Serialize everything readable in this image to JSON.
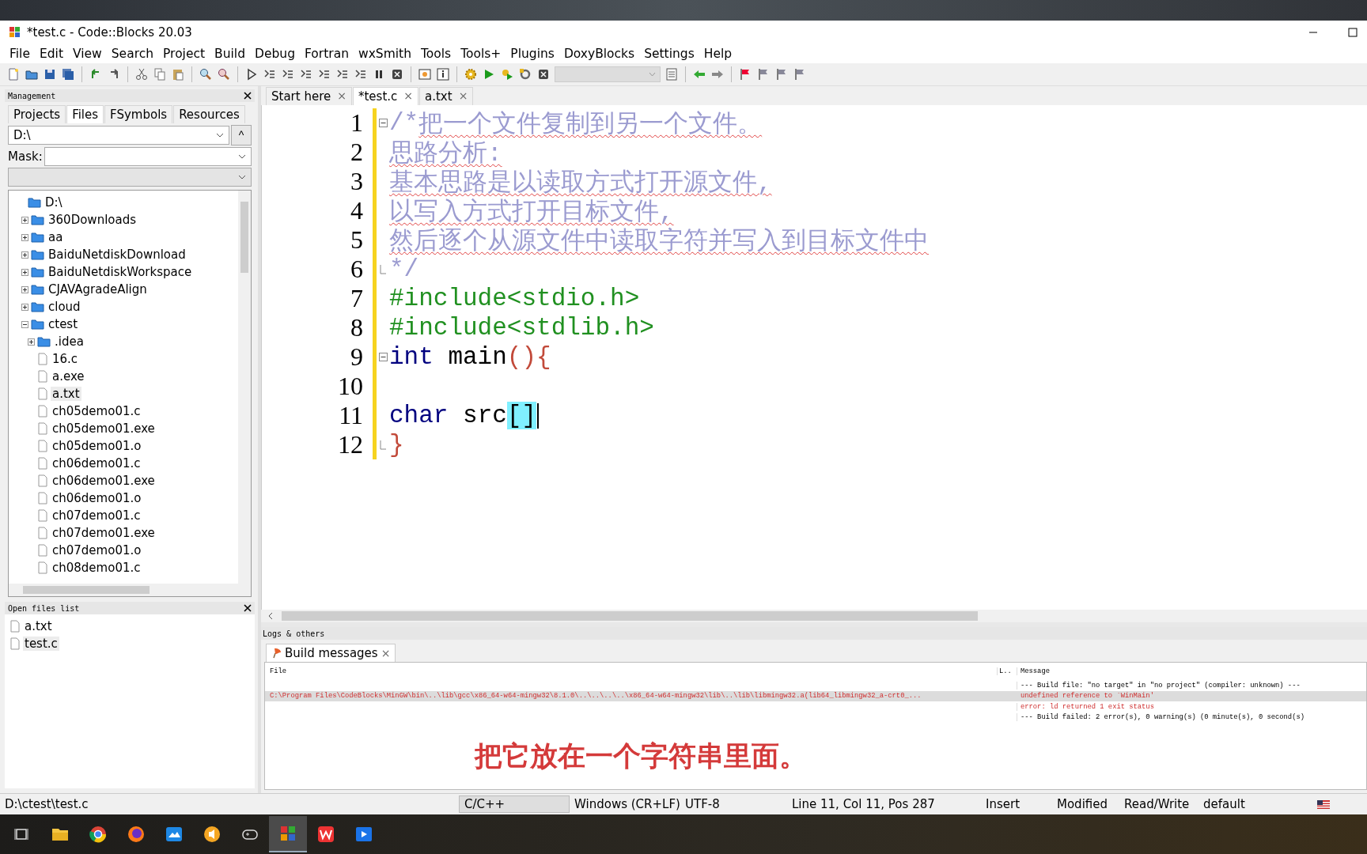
{
  "window": {
    "title": "*test.c - Code::Blocks 20.03"
  },
  "menu": [
    "File",
    "Edit",
    "View",
    "Search",
    "Project",
    "Build",
    "Debug",
    "Fortran",
    "wxSmith",
    "Tools",
    "Tools+",
    "Plugins",
    "DoxyBlocks",
    "Settings",
    "Help"
  ],
  "management": {
    "title": "Management",
    "tabs": [
      {
        "label": "Projects",
        "selected": false
      },
      {
        "label": "Files",
        "selected": true
      },
      {
        "label": "FSymbols",
        "selected": false
      },
      {
        "label": "Resources",
        "selected": false
      }
    ],
    "path": "D:\\",
    "up_button": "^",
    "mask_label": "Mask:",
    "tree": [
      {
        "label": "D:\\",
        "kind": "folder",
        "selected": false,
        "children": [
          {
            "label": "360Downloads",
            "kind": "folder",
            "expanded": false,
            "selected": false
          },
          {
            "label": "aa",
            "kind": "folder",
            "expanded": false,
            "selected": false
          },
          {
            "label": "BaiduNetdiskDownload",
            "kind": "folder",
            "expanded": false,
            "selected": false
          },
          {
            "label": "BaiduNetdiskWorkspace",
            "kind": "folder",
            "expanded": false,
            "selected": false
          },
          {
            "label": "CJAVAgradeAlign",
            "kind": "folder",
            "expanded": false,
            "selected": false
          },
          {
            "label": "cloud",
            "kind": "folder",
            "expanded": false,
            "selected": false
          },
          {
            "label": "ctest",
            "kind": "folder",
            "expanded": true,
            "selected": false,
            "children": [
              {
                "label": ".idea",
                "kind": "folder",
                "expanded": false,
                "selected": false
              },
              {
                "label": "16.c",
                "kind": "file",
                "selected": false
              },
              {
                "label": "a.exe",
                "kind": "file",
                "selected": false
              },
              {
                "label": "a.txt",
                "kind": "file",
                "selected": true
              },
              {
                "label": "ch05demo01.c",
                "kind": "file",
                "selected": false
              },
              {
                "label": "ch05demo01.exe",
                "kind": "file",
                "selected": false
              },
              {
                "label": "ch05demo01.o",
                "kind": "file",
                "selected": false
              },
              {
                "label": "ch06demo01.c",
                "kind": "file",
                "selected": false
              },
              {
                "label": "ch06demo01.exe",
                "kind": "file",
                "selected": false
              },
              {
                "label": "ch06demo01.o",
                "kind": "file",
                "selected": false
              },
              {
                "label": "ch07demo01.c",
                "kind": "file",
                "selected": false
              },
              {
                "label": "ch07demo01.exe",
                "kind": "file",
                "selected": false
              },
              {
                "label": "ch07demo01.o",
                "kind": "file",
                "selected": false
              },
              {
                "label": "ch08demo01.c",
                "kind": "file",
                "selected": false
              }
            ]
          }
        ]
      }
    ]
  },
  "open_files": {
    "title": "Open files list",
    "items": [
      {
        "label": "a.txt",
        "selected": false
      },
      {
        "label": "test.c",
        "selected": true
      }
    ]
  },
  "editor": {
    "tabs": [
      {
        "label": "Start here",
        "selected": false,
        "close": "×"
      },
      {
        "label": "*test.c",
        "selected": true,
        "close": "×"
      },
      {
        "label": "a.txt",
        "selected": false,
        "close": "×"
      }
    ],
    "lines": [
      {
        "number": "1",
        "fold_open": true,
        "fold_end": false,
        "changed": true,
        "caret": false,
        "tokens": [
          {
            "kind": "comment",
            "text": "/*"
          },
          {
            "kind": "comment-marked",
            "text": "把一个文件复制到另一个文件。"
          }
        ]
      },
      {
        "number": "2",
        "fold_open": false,
        "fold_end": false,
        "changed": true,
        "caret": false,
        "tokens": [
          {
            "kind": "comment-marked",
            "text": "思路分析:"
          }
        ]
      },
      {
        "number": "3",
        "fold_open": false,
        "fold_end": false,
        "changed": true,
        "caret": false,
        "tokens": [
          {
            "kind": "comment-marked",
            "text": "基本思路是以读取方式打开源文件,"
          }
        ]
      },
      {
        "number": "4",
        "fold_open": false,
        "fold_end": false,
        "changed": true,
        "caret": false,
        "tokens": [
          {
            "kind": "comment-marked",
            "text": "以写入方式打开目标文件,"
          }
        ]
      },
      {
        "number": "5",
        "fold_open": false,
        "fold_end": false,
        "changed": true,
        "caret": false,
        "tokens": [
          {
            "kind": "comment-marked",
            "text": "然后逐个从源文件中读取字符并写入到目标文件中"
          }
        ]
      },
      {
        "number": "6",
        "fold_open": false,
        "fold_end": true,
        "changed": true,
        "caret": false,
        "tokens": [
          {
            "kind": "comment",
            "text": "*/"
          }
        ]
      },
      {
        "number": "7",
        "fold_open": false,
        "fold_end": false,
        "changed": true,
        "caret": false,
        "tokens": [
          {
            "kind": "preproc",
            "text": "#include<stdio.h>"
          }
        ]
      },
      {
        "number": "8",
        "fold_open": false,
        "fold_end": false,
        "changed": true,
        "caret": false,
        "tokens": [
          {
            "kind": "preproc",
            "text": "#include<stdlib.h>"
          }
        ]
      },
      {
        "number": "9",
        "fold_open": true,
        "fold_end": false,
        "changed": true,
        "caret": false,
        "tokens": [
          {
            "kind": "keyword",
            "text": "int"
          },
          {
            "kind": "plain",
            "text": " main"
          },
          {
            "kind": "brace",
            "text": "(){"
          }
        ]
      },
      {
        "number": "10",
        "fold_open": false,
        "fold_end": false,
        "changed": true,
        "caret": false
      },
      {
        "number": "11",
        "fold_open": false,
        "fold_end": false,
        "changed": true,
        "caret": true,
        "tokens": [
          {
            "kind": "keyword",
            "text": "char"
          },
          {
            "kind": "plain",
            "text": " src"
          },
          {
            "kind": "match",
            "text": "[]"
          }
        ]
      },
      {
        "number": "12",
        "fold_open": false,
        "fold_end": true,
        "changed": true,
        "caret": false,
        "tokens": [
          {
            "kind": "brace",
            "text": "}"
          }
        ]
      }
    ]
  },
  "logs": {
    "title": "Logs & others",
    "tabs": [
      {
        "label": "Build messages",
        "selected": true,
        "close": "×"
      }
    ],
    "columns": [
      "File",
      "L..",
      "Message"
    ],
    "rows": [
      {
        "kind": "info",
        "selected": false,
        "message": "--- Build file: \"no target\" in \"no project\" (compiler: unknown) ---"
      },
      {
        "kind": "error",
        "selected": true,
        "file": "C:\\Program Files\\CodeBlocks\\MinGW\\bin\\..\\lib\\gcc\\x86_64-w64-mingw32\\8.1.0\\..\\..\\..\\..\\x86_64-w64-mingw32\\lib\\..\\lib\\libmingw32.a(lib64_libmingw32_a-crt0_...",
        "message": "undefined reference to `WinMain'"
      },
      {
        "kind": "error",
        "selected": false,
        "message": "error: ld returned 1 exit status"
      },
      {
        "kind": "info",
        "selected": false,
        "message": "--- Build failed: 2 error(s), 0 warning(s) (0 minute(s), 0 second(s)"
      }
    ]
  },
  "subtitle": "把它放在一个字符串里面。",
  "status_bar": [
    "D:\\ctest\\test.c",
    "C/C++",
    "Windows (CR+LF)",
    "UTF-8",
    "Line 11, Col 11, Pos 287",
    "Insert",
    "Modified",
    "Read/Write",
    "default"
  ],
  "taskbar": {
    "items": [
      {
        "selected": false
      },
      {
        "selected": false
      },
      {
        "selected": false
      },
      {
        "selected": false
      },
      {
        "selected": false
      },
      {
        "selected": false
      },
      {
        "selected": false
      },
      {
        "selected": true
      },
      {
        "selected": false
      },
      {
        "selected": false
      }
    ]
  }
}
